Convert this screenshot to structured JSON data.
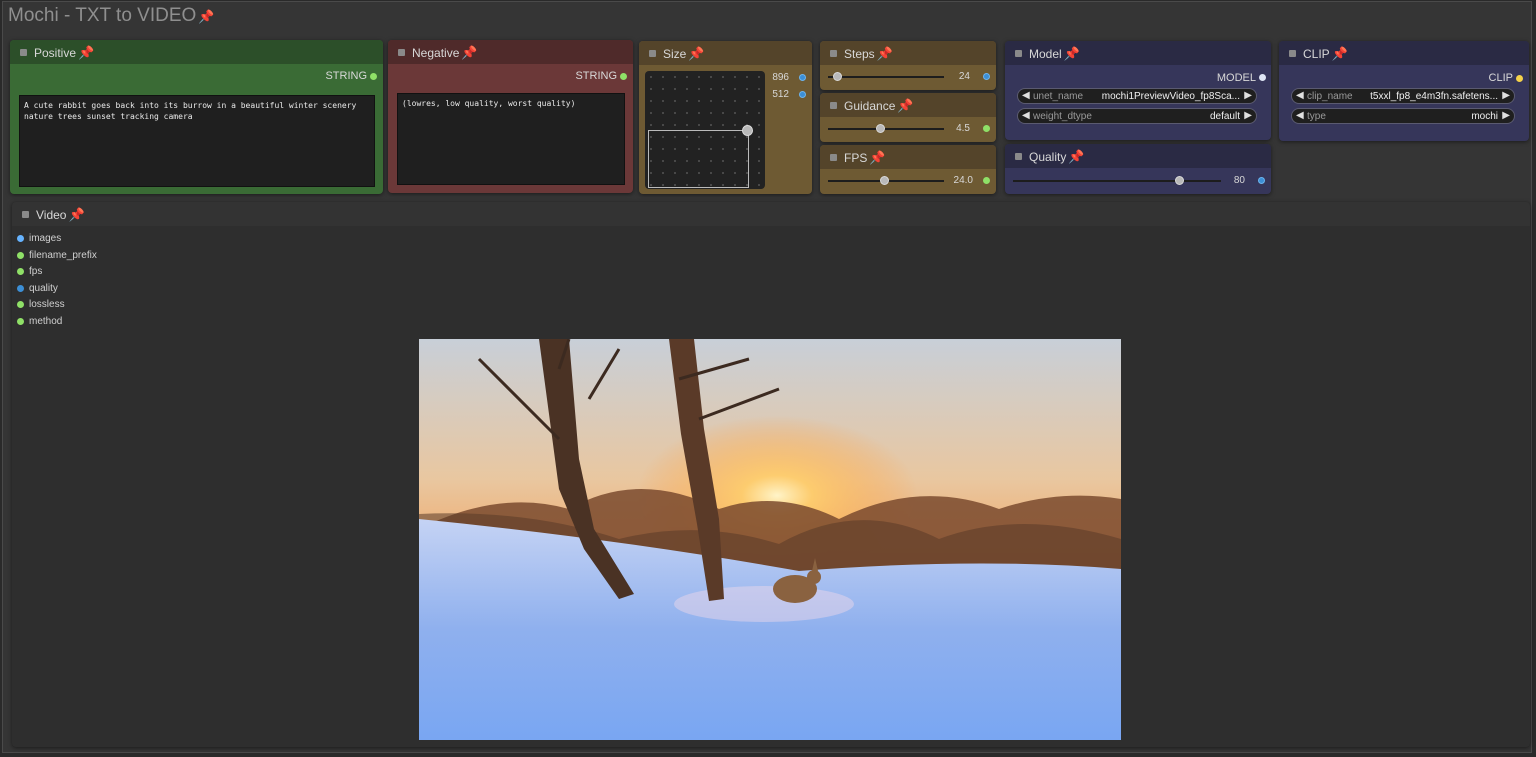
{
  "group": {
    "title": "Mochi - TXT to VIDEO",
    "pin_icon": "pushpin-icon"
  },
  "positive": {
    "title": "Positive",
    "output_label": "STRING",
    "text": "A cute rabbit goes back into its burrow in a beautiful winter scenery nature trees sunset tracking camera",
    "color": "#3a5a36"
  },
  "negative": {
    "title": "Negative",
    "output_label": "STRING",
    "text": "(lowres, low quality, worst quality)",
    "color": "#593131"
  },
  "size": {
    "title": "Size",
    "width": "896",
    "height": "512",
    "color": "#6b5530"
  },
  "steps": {
    "title": "Steps",
    "value": "24",
    "fraction": 0.08
  },
  "guidance": {
    "title": "Guidance",
    "value": "4.5",
    "fraction": 0.45
  },
  "fps": {
    "title": "FPS",
    "value": "24.0",
    "fraction": 0.48
  },
  "model": {
    "title": "Model",
    "output_label": "MODEL",
    "unet_name_label": "unet_name",
    "unet_name_value": "mochi1PreviewVideo_fp8Sca...",
    "weight_dtype_label": "weight_dtype",
    "weight_dtype_value": "default"
  },
  "quality": {
    "title": "Quality",
    "value": "80",
    "fraction": 0.8
  },
  "clip": {
    "title": "CLIP",
    "output_label": "CLIP",
    "clip_name_label": "clip_name",
    "clip_name_value": "t5xxl_fp8_e4m3fn.safetens...",
    "type_label": "type",
    "type_value": "mochi"
  },
  "video": {
    "title": "Video",
    "inputs": [
      {
        "label": "images",
        "color": "#66b3ff"
      },
      {
        "label": "filename_prefix",
        "color": "#8fe067"
      },
      {
        "label": "fps",
        "color": "#8fe067"
      },
      {
        "label": "quality",
        "color": "#3c8fd6"
      },
      {
        "label": "lossless",
        "color": "#8fe067"
      },
      {
        "label": "method",
        "color": "#8fe067"
      }
    ],
    "preview_description_icon": "video-preview-image"
  }
}
